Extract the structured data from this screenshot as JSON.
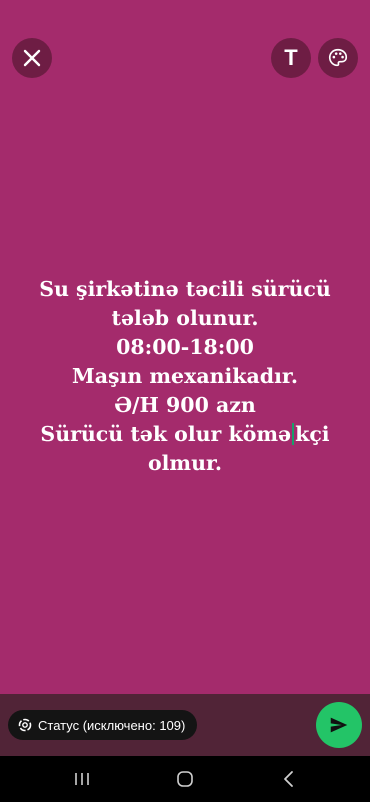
{
  "colors": {
    "background": "#a42b6c",
    "button_bg": "#6e1d44",
    "bottom_bar": "#512437",
    "send_button": "#23c467",
    "nav_bar": "#000000",
    "cursor": "#17a06a"
  },
  "toolbar": {
    "close_icon": "close-icon",
    "text_button_label": "T",
    "palette_icon": "palette-icon"
  },
  "status": {
    "lines_before_cursor": [
      "Su şirkətinə təcili sürücü",
      "tələb olunur.",
      "08:00-18:00",
      "Maşın mexanikadır.",
      "Ə/H 900 azn"
    ],
    "line6_before": "Sürücü tək olur kömə",
    "line6_after": "kçi",
    "line7": "olmur."
  },
  "bottom": {
    "audience_label": "Статус (исключено: 109)",
    "audience_icon": "status-ring-icon",
    "send_icon": "send-icon"
  },
  "nav": {
    "recents_icon": "recents-icon",
    "home_icon": "home-icon",
    "back_icon": "back-icon"
  }
}
